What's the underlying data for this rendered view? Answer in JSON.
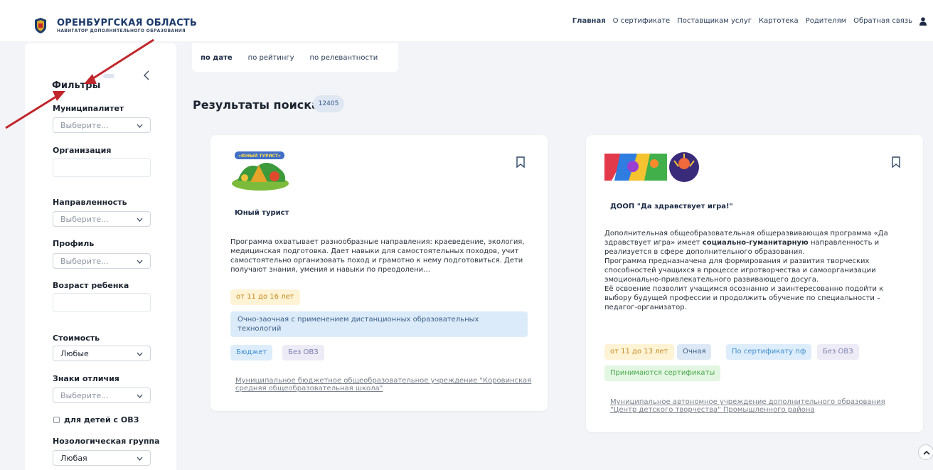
{
  "header": {
    "brand_title": "ОРЕНБУРГСКАЯ ОБЛАСТЬ",
    "brand_subtitle": "НАВИГАТОР ДОПОЛНИТЕЛЬНОГО ОБРАЗОВАНИЯ",
    "nav": [
      "Главная",
      "О сертификате",
      "Поставщикам услуг",
      "Картотека",
      "Родителям",
      "Обратная связь"
    ],
    "active_nav": "Главная"
  },
  "sidebar": {
    "title": "Фильтры",
    "municipality": {
      "label": "Муниципалитет",
      "placeholder": "Выберите..."
    },
    "organization": {
      "label": "Организация"
    },
    "direction": {
      "label": "Направленность",
      "placeholder": "Выберите..."
    },
    "profile": {
      "label": "Профиль",
      "placeholder": "Выберите..."
    },
    "age": {
      "label": "Возраст ребенка"
    },
    "cost": {
      "label": "Стоимость",
      "value": "Любые"
    },
    "badges": {
      "label": "Знаки отличия",
      "placeholder": "Выберите..."
    },
    "ovz_checkbox": {
      "label": "для детей с ОВЗ",
      "checked": false
    },
    "nosology": {
      "label": "Нозологическая группа",
      "value": "Любая"
    }
  },
  "sort": {
    "items": [
      "по дате",
      "по рейтингу",
      "по релевантности"
    ],
    "active": "по дате"
  },
  "results": {
    "title": "Результаты поиска",
    "count": "12405"
  },
  "cards": [
    {
      "thumb_text": "«ЮНЫЙ ТУРИСТ»",
      "title": "Юный турист",
      "description": "Программа охватывает разнообразные направления: краеведение, экология, медицинская подготовка. Дает навыки для самостоятельных походов, учит самостоятельно организовать поход и грамотно к нему подготовиться. Дети получают знания, умения и навыки по преодолени…",
      "age": "от 11 до 16 лет",
      "mode": "Очно-заочная с применением дистанционных образовательных технологий",
      "funding": "Бюджет",
      "ovz": "Без ОВЗ",
      "org": "Муниципальное бюджетное общеобразовательное учреждение \"Коровинская средняя общеобразовательная школа\""
    },
    {
      "title": "ДООП \"Да здравствует игра!\"",
      "desc_1": "Дополнительная общеобразовательная общеразвивающая программа «Да здравствует игра» имеет ",
      "desc_bold": "социально-гуманитарную",
      "desc_2": " направленность и реализуется в сфере дополнительного образования.",
      "desc_3": " Программа предназначена для формирования и развития творческих способностей учащихся в процессе  игротворчества и самоорганизации эмоционально-привлекательного развивающего досуга.",
      "desc_4": "Её освоение позволит учащимся осознанно и заинтересованно подойти к выбору будущей профессии и продолжить обучение по специальности – педагог-организатор.",
      "age": "от 11 до 13 лет",
      "mode": "Очная",
      "funding": "По сертификату пф",
      "ovz": "Без ОВЗ",
      "certificates": "Принимаются сертификаты",
      "org": "Муниципальное автономное учреждение дополнительного образования \"Центр детского творчества\" Промышленного района"
    }
  ],
  "colors": {
    "brand": "#1b3a6b",
    "arrow": "#c0262c",
    "age_tag": "#fff3d6",
    "blue_tag": "#deedfb",
    "green_tag": "#e2f6e2"
  }
}
